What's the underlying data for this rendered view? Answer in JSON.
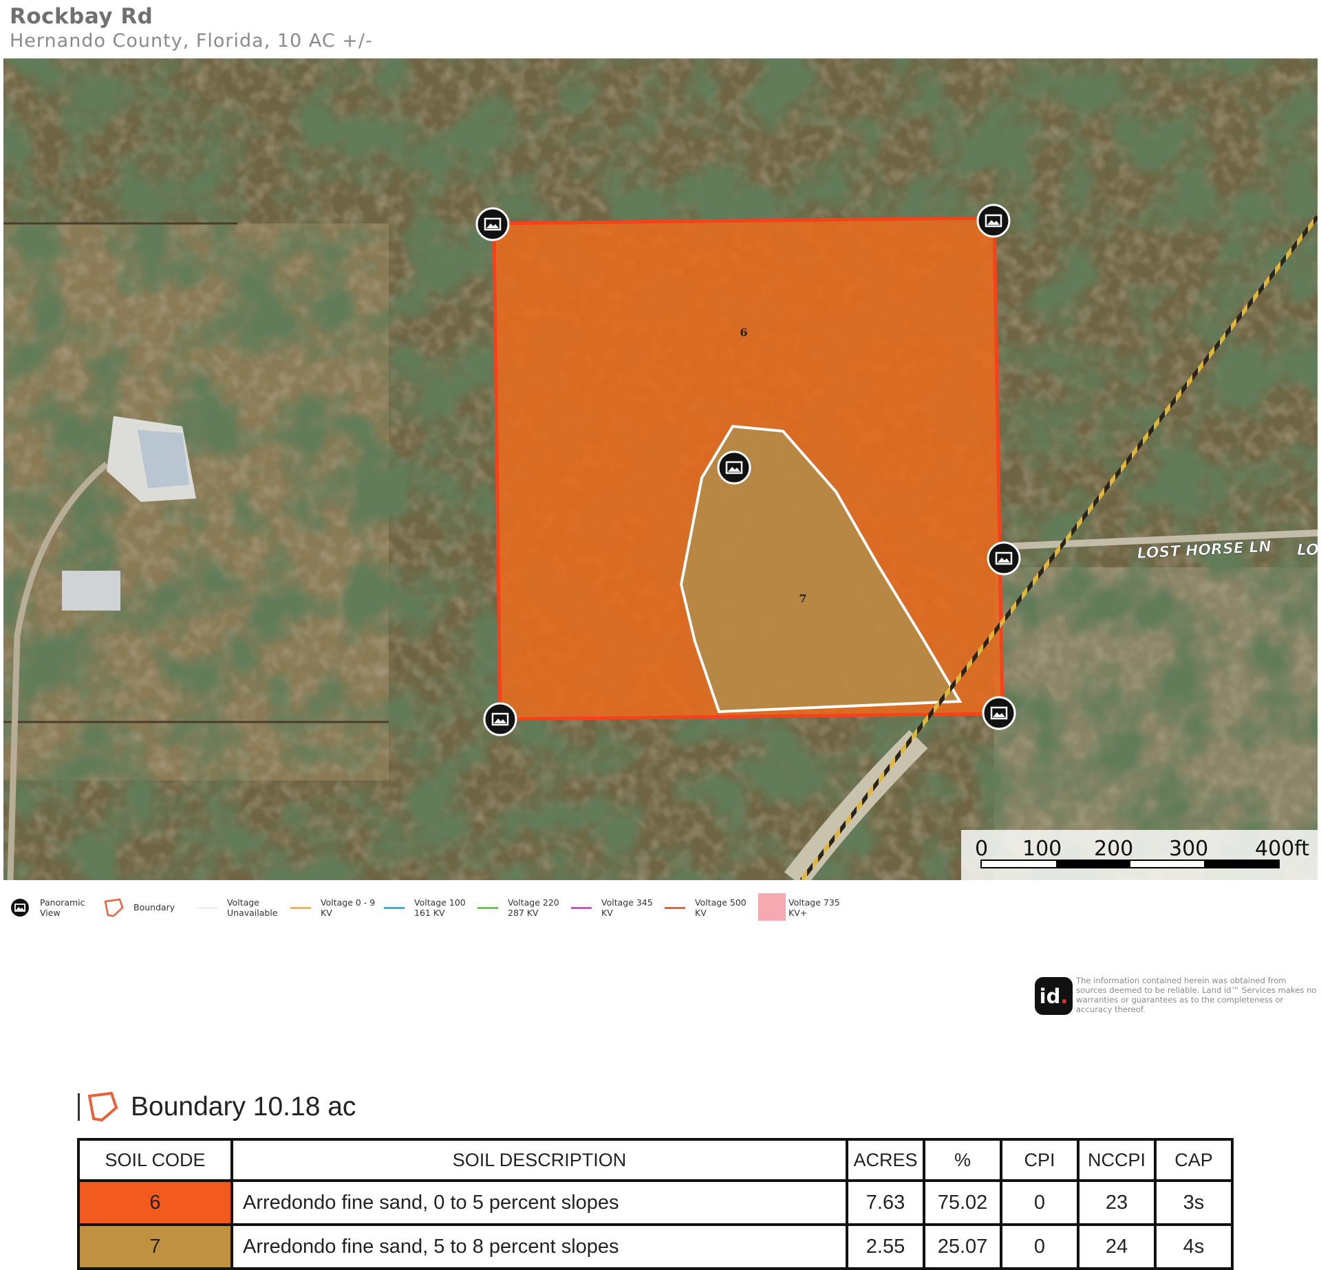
{
  "header": {
    "title": "Rockbay Rd",
    "subtitle": "Hernando County, Florida, 10 AC +/-"
  },
  "map": {
    "boundary_color": "#f26f1f",
    "soil_labels": [
      "6",
      "7"
    ],
    "road_label_main": "LOST HORSE LN",
    "road_label_cut": "LO",
    "scale": {
      "labels": [
        "0",
        "100",
        "200",
        "300",
        "400ft"
      ]
    }
  },
  "legend": [
    {
      "name": "legend-panoramic-view",
      "icon": "image-icon",
      "text": "Panoramic\nView"
    },
    {
      "name": "legend-boundary",
      "icon": "boundary-icon",
      "text": "Boundary"
    },
    {
      "name": "legend-voltage-unavailable",
      "icon": "line",
      "color": "#f0f0f0",
      "text": "Voltage\nUnavailable"
    },
    {
      "name": "legend-voltage-0-9",
      "icon": "line",
      "color": "#f5b34a",
      "text": "Voltage 0 - 9\nKV"
    },
    {
      "name": "legend-voltage-100-161",
      "icon": "line",
      "color": "#2fb7e4",
      "text": "Voltage 100\n161 KV"
    },
    {
      "name": "legend-voltage-220-287",
      "icon": "line",
      "color": "#6ac94c",
      "text": "Voltage 220\n287 KV"
    },
    {
      "name": "legend-voltage-345",
      "icon": "line",
      "color": "#d44bd8",
      "text": "Voltage 345\nKV"
    },
    {
      "name": "legend-voltage-500",
      "icon": "line",
      "color": "#e8613a",
      "text": "Voltage 500\nKV"
    },
    {
      "name": "legend-voltage-735",
      "icon": "box",
      "color": "#f7a9b2",
      "text": "Voltage 735\nKV+"
    }
  ],
  "disclaimer": {
    "logo_text": "id",
    "text": "The information contained herein was obtained from sources deemed to be reliable. Land id™ Services makes no warranties or guarantees as to the completeness or accuracy thereof."
  },
  "boundary": {
    "title": "Boundary 10.18 ac"
  },
  "soil_table": {
    "headers": [
      "SOIL CODE",
      "SOIL DESCRIPTION",
      "ACRES",
      "%",
      "CPI",
      "NCCPI",
      "CAP"
    ],
    "rows": [
      {
        "code": "6",
        "color": "#f35a1e",
        "description": "Arredondo fine sand, 0 to 5 percent slopes",
        "acres": "7.63",
        "percent": "75.02",
        "cpi": "0",
        "nccpi": "23",
        "cap": "3s"
      },
      {
        "code": "7",
        "color": "#bf9141",
        "description": "Arredondo fine sand, 5 to 8 percent slopes",
        "acres": "2.55",
        "percent": "25.07",
        "cpi": "0",
        "nccpi": "24",
        "cap": "4s"
      }
    ]
  }
}
